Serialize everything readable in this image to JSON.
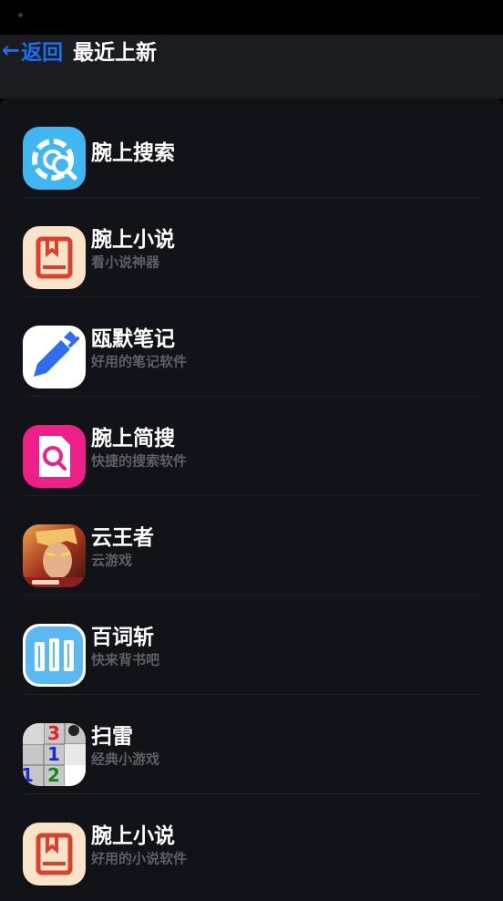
{
  "header": {
    "back_label": "返回",
    "title": "最近上新"
  },
  "apps": [
    {
      "name": "腕上搜索",
      "subtitle": "",
      "icon": "search-gear-icon",
      "color": "#3eb7f2"
    },
    {
      "name": "腕上小说",
      "subtitle": "看小说神器",
      "icon": "book-icon",
      "color": "#fbe3c9"
    },
    {
      "name": "瓯默笔记",
      "subtitle": "好用的笔记软件",
      "icon": "pen-icon",
      "color": "#ffffff"
    },
    {
      "name": "腕上简搜",
      "subtitle": "快捷的搜索软件",
      "icon": "document-search-icon",
      "color": "#ef1f8a"
    },
    {
      "name": "云王者",
      "subtitle": "云游戏",
      "icon": "game-hero-icon",
      "color": "#7a2a1e"
    },
    {
      "name": "百词斩",
      "subtitle": "快来背书吧",
      "icon": "word-cards-icon",
      "color": "#5bb9f2"
    },
    {
      "name": "扫雷",
      "subtitle": "经典小游戏",
      "icon": "minesweeper-icon",
      "color": "#c7c7c7"
    },
    {
      "name": "腕上小说",
      "subtitle": "好用的小说软件",
      "icon": "book-icon",
      "color": "#fbe3c9"
    }
  ]
}
